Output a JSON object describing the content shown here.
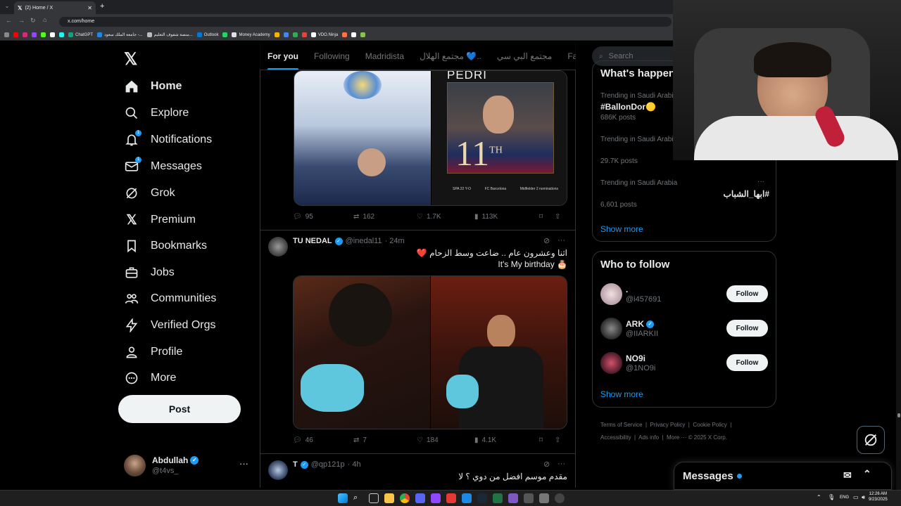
{
  "browser": {
    "tab_title": "(2) Home / X",
    "url": "x.com/home",
    "bookmarks": [
      "ChatGPT",
      "جامعة الملك سعود -...",
      "منصة شفوف التعليم...",
      "Outlook",
      "Money Academy",
      "VDO.Ninja"
    ]
  },
  "sidebar": {
    "logo": "X",
    "items": [
      {
        "label": "Home",
        "icon": "home-icon",
        "badge": ""
      },
      {
        "label": "Explore",
        "icon": "search-icon",
        "badge": ""
      },
      {
        "label": "Notifications",
        "icon": "bell-icon",
        "badge": "1"
      },
      {
        "label": "Messages",
        "icon": "envelope-icon",
        "badge": "1"
      },
      {
        "label": "Grok",
        "icon": "grok-icon",
        "badge": ""
      },
      {
        "label": "Premium",
        "icon": "x-logo-icon",
        "badge": ""
      },
      {
        "label": "Bookmarks",
        "icon": "bookmark-icon",
        "badge": ""
      },
      {
        "label": "Jobs",
        "icon": "briefcase-icon",
        "badge": ""
      },
      {
        "label": "Communities",
        "icon": "people-icon",
        "badge": ""
      },
      {
        "label": "Verified Orgs",
        "icon": "lightning-icon",
        "badge": ""
      },
      {
        "label": "Profile",
        "icon": "person-icon",
        "badge": ""
      },
      {
        "label": "More",
        "icon": "more-circle-icon",
        "badge": ""
      }
    ],
    "post_label": "Post",
    "account": {
      "name": "Abdullah",
      "handle": "@t4vs_"
    }
  },
  "feed": {
    "tabs": [
      "For you",
      "Following",
      "Madridista",
      "مجتمع الهلال 💙..",
      "مجتمع البي سي",
      "Fal"
    ],
    "post1": {
      "card_title": "PEDRI",
      "card_rank": "11",
      "card_rank_suffix": "TH",
      "card_footer": [
        "SPA 22 Y-O",
        "FC Barcelona",
        "Midfielder 2 nominations"
      ],
      "replies": "95",
      "reposts": "162",
      "likes": "1.7K",
      "views": "113K"
    },
    "post2": {
      "name": "TU NEDAL",
      "handle": "@inedal11",
      "time": "· 24m",
      "text_line1": "اثنا وعشرون عام .. ضاعت وسط الزحام ❤️",
      "text_line2": "It's My birthday 🎂",
      "replies": "46",
      "reposts": "7",
      "likes": "184",
      "views": "4.1K"
    },
    "post3": {
      "name": "T",
      "handle": "@qp121p",
      "time": "· 4h",
      "text": "مقدم موسم افضل من دوي ؟ لا"
    }
  },
  "right": {
    "search_placeholder": "Search",
    "trends_title": "What's happen",
    "trends": [
      {
        "category": "Trending in Saudi Arabia",
        "name": "#BallonDor🟡",
        "posts": "686K posts"
      },
      {
        "category": "Trending in Saudi Arabia",
        "name": "",
        "posts": "29.7K posts"
      },
      {
        "category": "Trending in Saudi Arabia",
        "name": "#ابها_الشباب",
        "posts": "6,601 posts"
      }
    ],
    "trends_show_more": "Show more",
    "who_title": "Who to follow",
    "follow_label": "Follow",
    "suggestions": [
      {
        "name": ".",
        "handle": "@i457691",
        "verified": false
      },
      {
        "name": "ARK",
        "handle": "@IIARKII",
        "verified": true
      },
      {
        "name": "NO9i",
        "handle": "@1NO9i",
        "verified": false
      }
    ],
    "who_show_more": "Show more",
    "footer_line1": [
      "Terms of Service",
      "Privacy Policy",
      "Cookie Policy"
    ],
    "footer_line2": [
      "Accessibility",
      "Ads info",
      "More ···",
      "© 2025 X Corp."
    ]
  },
  "messages_dock": {
    "label": "Messages"
  },
  "taskbar": {
    "lang": "ENG",
    "time": "12:26 AM",
    "date": "9/23/2025"
  },
  "colors": {
    "accent": "#1d9bf0",
    "background": "#000000",
    "border": "#2f3336",
    "muted": "#71767b",
    "like_heart": "#f91880"
  }
}
